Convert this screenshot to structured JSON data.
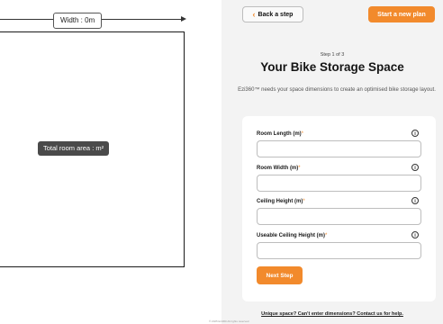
{
  "canvas": {
    "width_label": "Width : 0m",
    "area_label": "Total room area : m²"
  },
  "header": {
    "back_label": "Back a step",
    "back_icon": "chevron-left-icon",
    "new_plan_label": "Start a new plan"
  },
  "intro": {
    "step": "Step 1 of 3",
    "title": "Your Bike Storage Space",
    "description": "Ezi360™ needs your space dimensions to create an optimised bike storage layout."
  },
  "form": {
    "fields": [
      {
        "label": "Room Length (m)",
        "required_mark": "*",
        "value": "",
        "info_icon": "info-icon"
      },
      {
        "label": "Room Width (m)",
        "required_mark": "*",
        "value": "",
        "info_icon": "info-icon"
      },
      {
        "label": "Ceiling Height (m)",
        "required_mark": "*",
        "value": "",
        "info_icon": "info-icon"
      },
      {
        "label": "Useable Ceiling Height (m)",
        "required_mark": "*",
        "value": "",
        "info_icon": "info-icon"
      }
    ],
    "next_label": "Next Step"
  },
  "footer": {
    "help_link": "Unique space? Can't enter dimensions? Contact us for help.",
    "footnote": "® 2025 Ezi360 All rights reserved"
  },
  "colors": {
    "accent": "#f28a2c",
    "panel_bg": "#f3f3f3",
    "card_bg": "#ffffff"
  }
}
